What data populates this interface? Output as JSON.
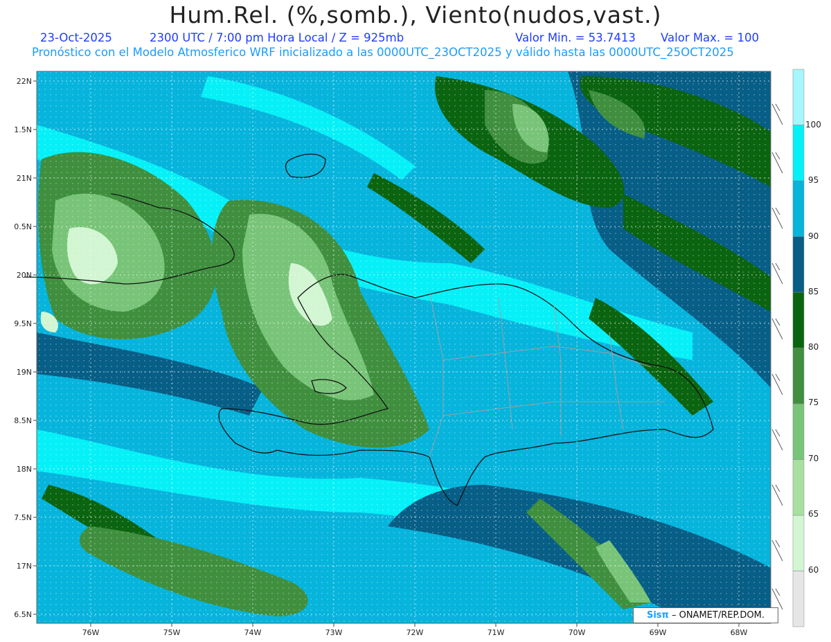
{
  "header": {
    "title": "Hum.Rel. (%,somb.), Viento(nudos,vast.)",
    "date": "23-Oct-2025",
    "time": "2300 UTC / 7:00 pm Hora Local / Z = 925mb",
    "valmin": "Valor Min. = 53.7413",
    "valmax": "Valor Max. = 100",
    "model_line": "Pronóstico con el Modelo Atmosferico WRF inicializado a las 0000UTC_23OCT2025 y válido hasta las  0000UTC_25OCT2025"
  },
  "axes": {
    "lat_labels": [
      "22N",
      "1.5N",
      "21N",
      "0.5N",
      "20N",
      "9.5N",
      "19N",
      "8.5N",
      "18N",
      "7.5N",
      "17N",
      "6.5N"
    ],
    "lon_labels": [
      "76W",
      "75W",
      "74W",
      "73W",
      "72W",
      "71W",
      "70W",
      "69W",
      "68W"
    ]
  },
  "legend": {
    "labels": [
      "60",
      "65",
      "70",
      "75",
      "80",
      "85",
      "90",
      "95",
      "100"
    ],
    "colors": [
      "#e6e6e6",
      "#d2f5d2",
      "#a8e0a0",
      "#78c478",
      "#3f8f3f",
      "#0b6410",
      "#075e86",
      "#06b4dc",
      "#06f0f8",
      "#a6f6fa"
    ]
  },
  "credit": {
    "logo": "Sisπ",
    "text": "– ONAMET/REP.DOM."
  }
}
